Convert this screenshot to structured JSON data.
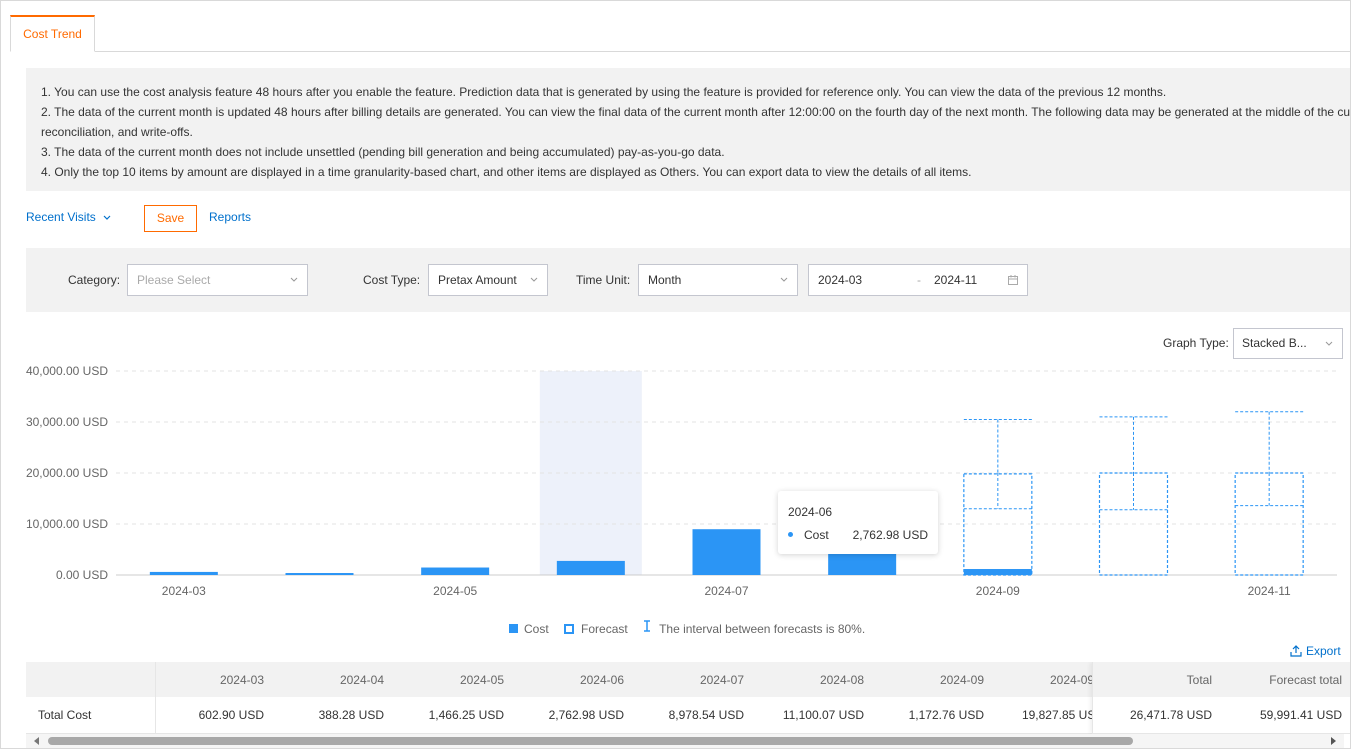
{
  "tabs": [
    {
      "label": "Cost Trend",
      "active": true
    }
  ],
  "notices": [
    "1. You can use the cost analysis feature 48 hours after you enable the feature. Prediction data that is generated by using the feature is provided for reference only. You can view the data of the previous 12 months.",
    "2. The data of the current month is updated 48 hours after billing details are generated. You can view the final data of the current month after 12:00:00 on the fourth day of the next month. The following data may be generated at the middle of the cu",
    "reconciliation, and write-offs.",
    "3. The data of the current month does not include unsettled (pending bill generation and being accumulated) pay-as-you-go data.",
    "4. Only the top 10 items by amount are displayed in a time granularity-based chart, and other items are displayed as Others. You can export data to view the details of all items."
  ],
  "toolbar": {
    "recent_visits": "Recent Visits",
    "save": "Save",
    "reports": "Reports"
  },
  "filters": {
    "category_label": "Category:",
    "category_placeholder": "Please Select",
    "cost_type_label": "Cost Type:",
    "cost_type_value": "Pretax Amount",
    "time_unit_label": "Time Unit:",
    "time_unit_value": "Month",
    "date_from": "2024-03",
    "date_to": "2024-11",
    "date_separator": "-"
  },
  "graph_type": {
    "label": "Graph Type:",
    "value": "Stacked B..."
  },
  "colors": {
    "cost": "#2b95f5",
    "forecast": "#2b95f5",
    "accent": "#ff6a00",
    "link": "#0070cc",
    "highlight": "#edf1fa"
  },
  "chart_data": {
    "type": "bar",
    "stacked": true,
    "categories": [
      "2024-03",
      "2024-04",
      "2024-05",
      "2024-06",
      "2024-07",
      "2024-08",
      "2024-09",
      "2024-10",
      "2024-11"
    ],
    "x_tick_labels": [
      "2024-03",
      "2024-05",
      "2024-07",
      "2024-09",
      "2024-11"
    ],
    "y_ticks": [
      "0.00 USD",
      "10,000.00 USD",
      "20,000.00 USD",
      "30,000.00 USD",
      "40,000.00 USD"
    ],
    "ylim": [
      0,
      40000
    ],
    "grid": true,
    "highlighted_category": "2024-06",
    "series": [
      {
        "name": "Cost",
        "values": [
          602.9,
          388.28,
          1466.25,
          2762.98,
          8978.54,
          11100.07,
          1172.76,
          null,
          null
        ]
      },
      {
        "name": "Forecast",
        "values": [
          null,
          null,
          null,
          null,
          null,
          null,
          19827.85,
          20000,
          20000
        ]
      }
    ],
    "forecast_interval": [
      {
        "category": "2024-09",
        "low": 13000,
        "mid": 20000,
        "high": 30500
      },
      {
        "category": "2024-10",
        "low": 12800,
        "mid": 20000,
        "high": 31000
      },
      {
        "category": "2024-11",
        "low": 13600,
        "mid": 20000,
        "high": 32000
      }
    ],
    "legend": {
      "cost": "Cost",
      "forecast": "Forecast",
      "interval": "The interval between forecasts is 80%."
    },
    "tooltip": {
      "title": "2024-06",
      "name": "Cost",
      "value": "2,762.98 USD"
    }
  },
  "export_label": "Export",
  "table": {
    "columns": [
      "2024-03",
      "2024-04",
      "2024-05",
      "2024-06",
      "2024-07",
      "2024-08",
      "2024-09",
      "2024-09"
    ],
    "row_label": "Total Cost",
    "values": [
      "602.90 USD",
      "388.28 USD",
      "1,466.25 USD",
      "2,762.98 USD",
      "8,978.54 USD",
      "11,100.07 USD",
      "1,172.76 USD",
      "19,827.85 USD"
    ],
    "total_header": "Total",
    "forecast_total_header": "Forecast total",
    "total_value": "26,471.78 USD",
    "forecast_total_value": "59,991.41 USD"
  }
}
